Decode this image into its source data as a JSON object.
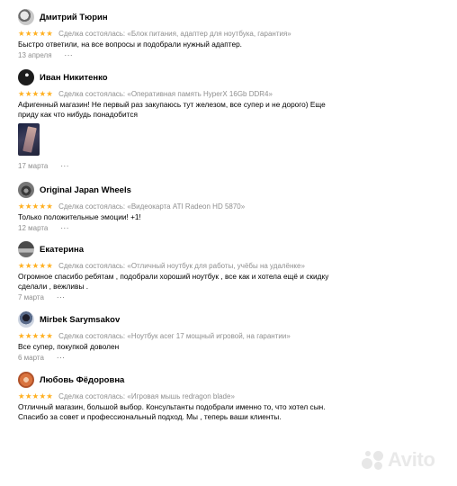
{
  "stars_glyph": "★★★★★",
  "more_glyph": "···",
  "reviews": [
    {
      "author": "Дмитрий Тюрин",
      "deal": "Сделка состоялась: «Блок питания, адаптер для ноутбука, гарантия»",
      "text": "Быстро ответили, на все вопросы и подобрали нужный адаптер.",
      "date": "13 апреля"
    },
    {
      "author": "Иван Никитенко",
      "deal": "Сделка состоялась: «Оперативная память HyperX 16Gb DDR4»",
      "text": "Афигенный магазин! Не первый раз закупаюсь тут железом, все супер и не дорого) Еще приду как что нибудь понадобится",
      "date": "17 марта"
    },
    {
      "author": "Original Japan Wheels",
      "deal": "Сделка состоялась: «Видеокарта ATI Radeon HD 5870»",
      "text": "Только положительные эмоции! +1!",
      "date": "12 марта"
    },
    {
      "author": "Екатерина",
      "deal": "Сделка состоялась: «Отличный ноутбук для работы, учёбы на удалёнке»",
      "text": "Огромное спасибо ребятам , подобрали хороший ноутбук , все как и хотела ещё и скидку сделали , вежливы .",
      "date": "7 марта"
    },
    {
      "author": "Mirbek Sarymsakov",
      "deal": "Сделка состоялась: «Ноутбук асег 17 мощный игровой, на гарантии»",
      "text": "Все супер, покупкой доволен",
      "date": "6 марта"
    },
    {
      "author": "Любовь Фёдоровна",
      "deal": "Сделка состоялась: «Игровая мышь redragon blade»",
      "text": "Отличный магазин, большой выбор. Консультанты подобрали именно то, что хотел сын. Спасибо за совет и профессиональный подход. Мы , теперь ваши клиенты.",
      "date": ""
    }
  ],
  "watermark": "Avito",
  "colors": {
    "stars": "#ffb021",
    "muted": "#8f8f8f"
  }
}
